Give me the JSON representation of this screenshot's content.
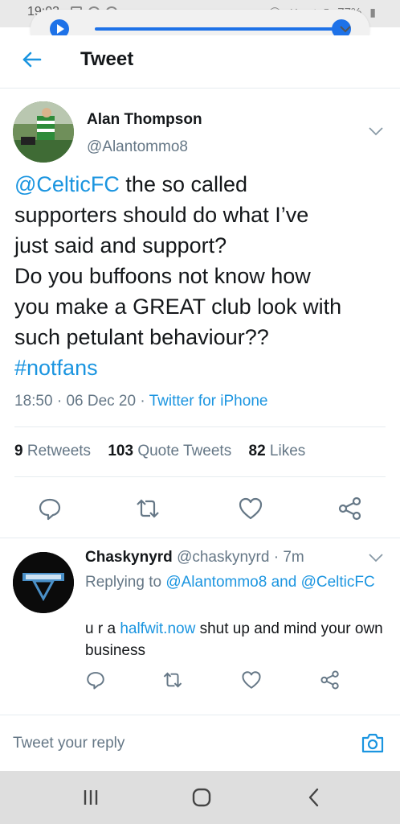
{
  "status_bar": {
    "time": "19:03",
    "battery": "77%"
  },
  "header": {
    "title": "Tweet"
  },
  "tweet": {
    "author_name": "Alan Thompson",
    "author_handle": "@Alantommo8",
    "text_lines": [
      {
        "mention": "@CelticFC",
        "rest": " the so called"
      },
      "supporters should do what I’ve",
      "just said and support?",
      "Do you buffoons not know how",
      "you make a GREAT club look with",
      "such petulant behaviour??"
    ],
    "hashtag": "#notfans",
    "time": "18:50",
    "date": "06 Dec 20",
    "source": "Twitter for iPhone",
    "stats": {
      "retweets_count": "9",
      "retweets_label": "Retweets",
      "quotes_count": "103",
      "quotes_label": "Quote Tweets",
      "likes_count": "82",
      "likes_label": "Likes"
    }
  },
  "reply": {
    "author_name": "Chaskynyrd",
    "author_handle": "@chaskynyrd",
    "age": "7m",
    "replying_prefix": "Replying to",
    "replying_user1": "@Alantommo8",
    "replying_and": "and",
    "replying_user2": "@CelticFC",
    "text_prefix": "u r a ",
    "text_link": "halfwit.now",
    "text_suffix": " shut  up and mind your own business"
  },
  "composer": {
    "placeholder": "Tweet your reply"
  },
  "colors": {
    "accent": "#1b95e0",
    "secondary_text": "#657786",
    "primary_text": "#14171a",
    "media_blue": "#1e72e8"
  },
  "icons": [
    "back-arrow-icon",
    "chevron-down-icon",
    "reply-icon",
    "retweet-icon",
    "like-icon",
    "share-icon",
    "camera-icon",
    "play-icon",
    "recents-icon",
    "home-icon",
    "back-nav-icon"
  ]
}
